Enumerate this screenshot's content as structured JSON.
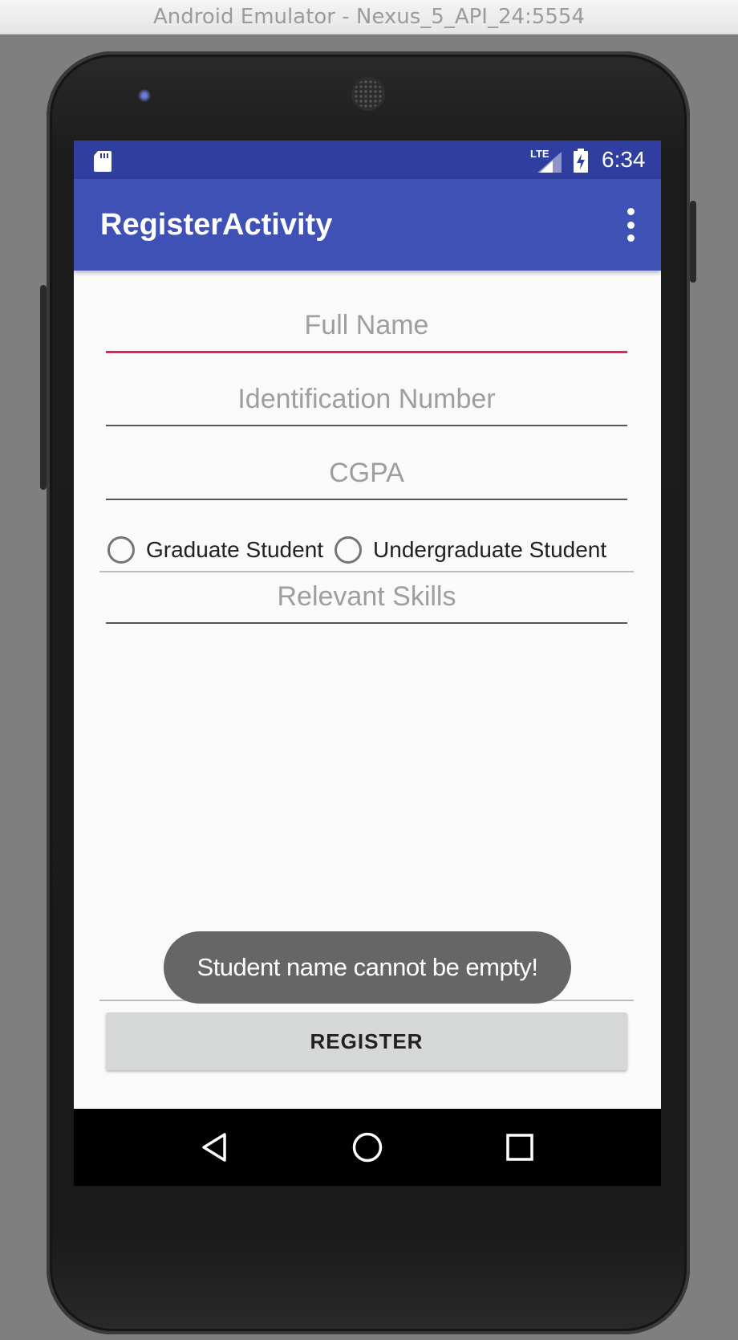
{
  "window": {
    "title": "Android Emulator - Nexus_5_API_24:5554"
  },
  "statusbar": {
    "time": "6:34",
    "network": "LTE"
  },
  "appbar": {
    "title": "RegisterActivity"
  },
  "form": {
    "full_name": {
      "placeholder": "Full Name",
      "value": ""
    },
    "id_number": {
      "placeholder": "Identification Number",
      "value": ""
    },
    "cgpa": {
      "placeholder": "CGPA",
      "value": ""
    },
    "student_type": {
      "options": [
        "Graduate Student",
        "Undergraduate Student"
      ],
      "selected": null
    },
    "skills": {
      "placeholder": "Relevant Skills",
      "value": ""
    }
  },
  "toast": {
    "message": "Student name cannot be empty!"
  },
  "register_button": {
    "label": "REGISTER"
  },
  "colors": {
    "primary": "#3f51b5",
    "primary_dark": "#303f9f",
    "accent": "#e91e63"
  }
}
